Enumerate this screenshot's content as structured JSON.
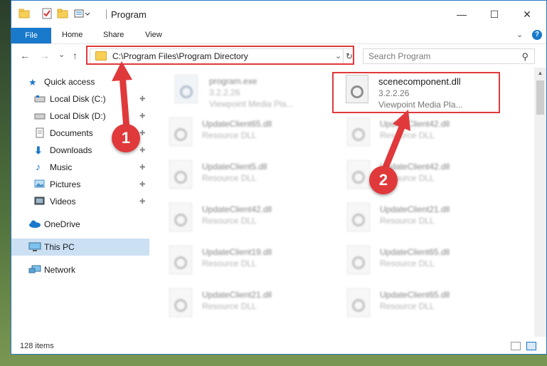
{
  "titlebar": {
    "title": "Program",
    "minimize": "—",
    "maximize": "☐",
    "close": "✕"
  },
  "ribbon": {
    "file": "File",
    "home": "Home",
    "share": "Share",
    "view": "View",
    "help": "?"
  },
  "nav": {
    "back": "←",
    "forward": "→",
    "recent": "⌄",
    "up": "↑",
    "address": "C:\\Program Files\\Program Directory",
    "address_chevron": "⌄",
    "refresh": "↻",
    "search_placeholder": "Search Program",
    "search_icon": "⚲"
  },
  "sidebar": {
    "items": [
      {
        "label": "Quick access",
        "icon": "star-icon",
        "pinned": false
      },
      {
        "label": "Local Disk (C:)",
        "icon": "drive-icon",
        "pinned": true
      },
      {
        "label": "Local Disk (D:)",
        "icon": "drive-icon",
        "pinned": true
      },
      {
        "label": "Documents",
        "icon": "document-icon",
        "pinned": true
      },
      {
        "label": "Downloads",
        "icon": "download-icon",
        "pinned": true
      },
      {
        "label": "Music",
        "icon": "music-icon",
        "pinned": true
      },
      {
        "label": "Pictures",
        "icon": "picture-icon",
        "pinned": true
      },
      {
        "label": "Videos",
        "icon": "video-icon",
        "pinned": true
      },
      {
        "label": "OneDrive",
        "icon": "cloud-icon",
        "pinned": false
      },
      {
        "label": "This PC",
        "icon": "computer-icon",
        "pinned": false
      },
      {
        "label": "Network",
        "icon": "network-icon",
        "pinned": false
      }
    ],
    "pin_glyph": "📌"
  },
  "files": [
    {
      "name": "program.exe",
      "version": "3.2.2.26",
      "desc": "Viewpoint Media Pla...",
      "blurred": true
    },
    {
      "name": "scenecomponent.dll",
      "version": "3.2.2.26",
      "desc": "Viewpoint Media Pla...",
      "blurred": false
    },
    {
      "name": "UpdateClient65.dll",
      "version": "Resource DLL",
      "blurred": true
    },
    {
      "name": "UpdateClient42.dll",
      "version": "Resource DLL",
      "blurred": true
    },
    {
      "name": "UpdateClient5.dll",
      "version": "Resource DLL",
      "blurred": true
    },
    {
      "name": "UpdateClient42.dll",
      "version": "Resource DLL",
      "blurred": true
    },
    {
      "name": "UpdateClient42.dll",
      "version": "Resource DLL",
      "blurred": true
    },
    {
      "name": "UpdateClient21.dll",
      "version": "Resource DLL",
      "blurred": true
    },
    {
      "name": "UpdateClient19.dll",
      "version": "Resource DLL",
      "blurred": true
    },
    {
      "name": "UpdateClient65.dll",
      "version": "Resource DLL",
      "blurred": true
    },
    {
      "name": "UpdateClient21.dll",
      "version": "Resource DLL",
      "blurred": true
    },
    {
      "name": "UpdateClient65.dll",
      "version": "Resource DLL",
      "blurred": true
    }
  ],
  "status": {
    "count": "128 items"
  },
  "annotations": {
    "step1": "1",
    "step2": "2",
    "color": "#e0393b"
  },
  "colors": {
    "accent": "#1979ca",
    "selected": "#cce0f4",
    "highlight": "#e0393b"
  }
}
